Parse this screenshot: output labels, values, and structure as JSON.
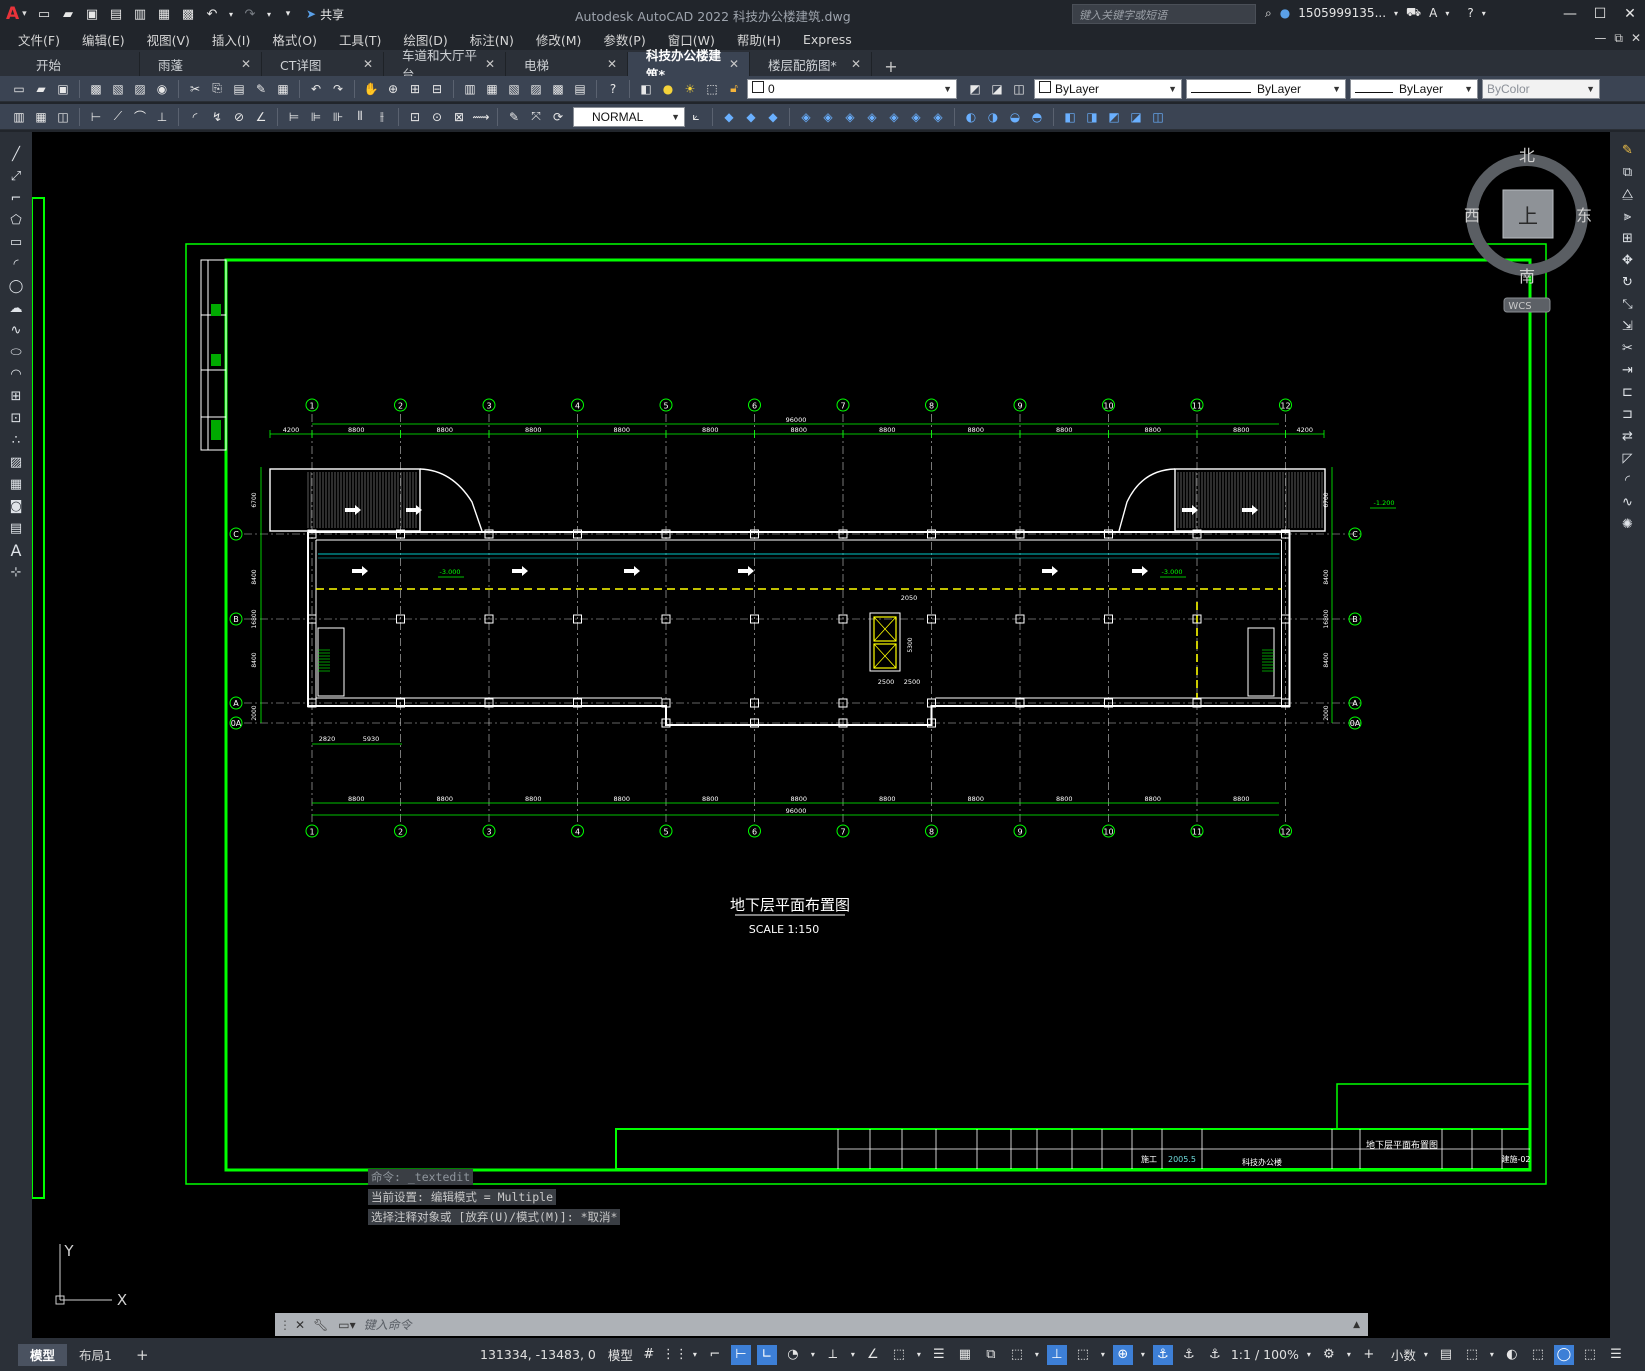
{
  "app": {
    "title": "Autodesk AutoCAD 2022    科技办公楼建筑.dwg",
    "share_label": "共享",
    "search_placeholder": "键入关键字或短语",
    "user_name": "1505999135...",
    "logo_letter": "A"
  },
  "menu": [
    "文件(F)",
    "编辑(E)",
    "视图(V)",
    "插入(I)",
    "格式(O)",
    "工具(T)",
    "绘图(D)",
    "标注(N)",
    "修改(M)",
    "参数(P)",
    "窗口(W)",
    "帮助(H)",
    "Express"
  ],
  "tabs": [
    {
      "label": "开始",
      "active": false
    },
    {
      "label": "雨蓬",
      "active": false
    },
    {
      "label": "CT详图",
      "active": false
    },
    {
      "label": "车道和大厅平台",
      "active": false
    },
    {
      "label": "电梯",
      "active": false
    },
    {
      "label": "科技办公楼建筑*",
      "active": true
    },
    {
      "label": "楼层配筋图*",
      "active": false
    }
  ],
  "properties": {
    "layer_value": "0",
    "color_value": "ByLayer",
    "linetype_value": "ByLayer",
    "lineweight_value": "ByLayer",
    "plotstyle_value": "ByColor",
    "dimstyle_value": "NORMAL"
  },
  "viewcube": {
    "north": "北",
    "south": "南",
    "east": "东",
    "west": "西",
    "top": "上",
    "wcs": "WCS"
  },
  "drawing": {
    "title": "地下层平面布置图",
    "scale": "SCALE 1:150",
    "axis_numbers": [
      "1",
      "2",
      "3",
      "4",
      "5",
      "6",
      "7",
      "8",
      "9",
      "10",
      "11",
      "12"
    ],
    "axis_letters_left": [
      "C",
      "B",
      "A",
      "0A"
    ],
    "axis_letters_right": [
      "C",
      "B",
      "A",
      "0A"
    ],
    "top_dims": [
      "4200",
      "8800",
      "8800",
      "8800",
      "8800",
      "8800",
      "8800",
      "8800",
      "8800",
      "8800",
      "8800",
      "8800",
      "4200"
    ],
    "total_dim": "96000",
    "bottom_dims": [
      "8800",
      "8800",
      "8800",
      "8800",
      "8800",
      "8800",
      "8800",
      "8800",
      "8800",
      "8800",
      "8800"
    ],
    "elev_left": "-3.000",
    "elev_right": "-3.000",
    "elev_exit": "-1.200",
    "small_dims": [
      "2820",
      "5930",
      "2050",
      "2500",
      "2500",
      "5300"
    ],
    "side_dims": [
      "6700",
      "8400",
      "16800",
      "8400",
      "2000"
    ]
  },
  "title_block": {
    "drawing_name": "地下层平面布置图",
    "date": "2005.5",
    "project": "科技办公楼",
    "stage": "施工",
    "number": "建施-02"
  },
  "ucs": {
    "x": "X",
    "y": "Y"
  },
  "command": {
    "history": [
      "命令: _textedit",
      "当前设置: 编辑模式 = Multiple",
      "选择注释对象或 [放弃(U)/模式(M)]: *取消*"
    ],
    "placeholder": "键入命令"
  },
  "status": {
    "layout_tabs": [
      "模型",
      "布局1"
    ],
    "coords": "131334, -13483, 0",
    "mode": "模型",
    "scale": "1:1 / 100%",
    "units": "小数"
  },
  "colors": {
    "accent": "#3d7fd6",
    "canvas": "#000000",
    "border_green": "#00ff00",
    "toolbar": "#3b4453"
  }
}
